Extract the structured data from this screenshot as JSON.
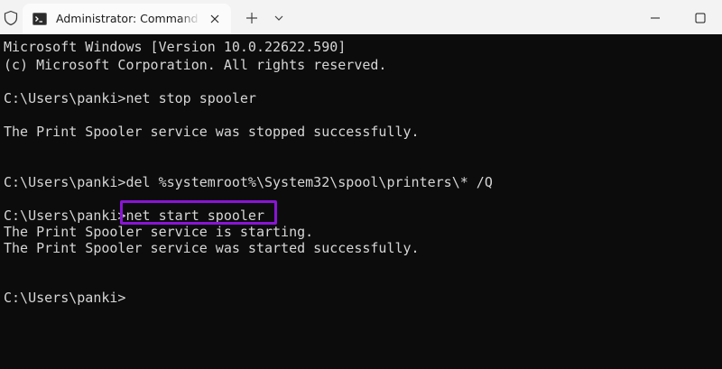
{
  "titlebar": {
    "tab_title": "Administrator: Command Prompt",
    "icons": {
      "shield": "shield-icon",
      "tab": "terminal-icon",
      "close": "close-icon",
      "new_tab": "plus-icon",
      "dropdown": "chevron-down-icon",
      "minimize": "minimize-icon",
      "maximize": "maximize-icon"
    }
  },
  "terminal": {
    "lines": [
      "Microsoft Windows [Version 10.0.22622.590]",
      "(c) Microsoft Corporation. All rights reserved.",
      "C:\\Users\\panki>net stop spooler",
      "The Print Spooler service was stopped successfully.",
      "C:\\Users\\panki>del %systemroot%\\System32\\spool\\printers\\* /Q",
      "C:\\Users\\panki>net start spooler",
      "The Print Spooler service is starting.",
      "The Print Spooler service was started successfully.",
      "C:\\Users\\panki>"
    ],
    "highlight_color": "#8a14d6"
  },
  "colors": {
    "titlebar_bg": "#f3f3f3",
    "tab_bg": "#fbfbfb",
    "terminal_bg": "#0c0c0c",
    "terminal_text": "#d6d6d6"
  }
}
